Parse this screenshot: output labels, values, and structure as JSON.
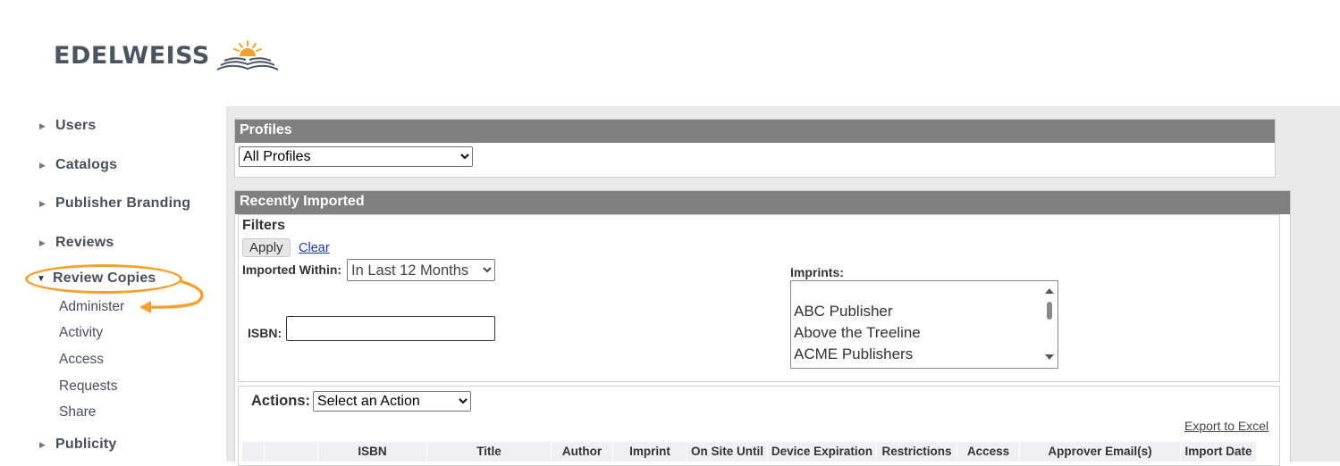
{
  "brand": {
    "logo_text": "EDELWEISS"
  },
  "sidebar": {
    "sections": [
      {
        "label": "Users",
        "expanded": false
      },
      {
        "label": "Catalogs",
        "expanded": false
      },
      {
        "label": "Publisher Branding",
        "expanded": false
      },
      {
        "label": "Reviews",
        "expanded": false
      },
      {
        "label": "Review Copies",
        "expanded": true
      },
      {
        "label": "Publicity",
        "expanded": false
      }
    ],
    "review_copies_items": [
      "Administer",
      "Activity",
      "Access",
      "Requests",
      "Share"
    ]
  },
  "profiles": {
    "header": "Profiles",
    "selected": "All Profiles"
  },
  "recently_imported": {
    "header": "Recently Imported",
    "filters": {
      "title": "Filters",
      "apply_label": "Apply",
      "clear_label": "Clear",
      "imported_within_label": "Imported Within:",
      "imported_within_value": "In Last 12 Months",
      "isbn_label": "ISBN:",
      "isbn_value": "",
      "imprints_label": "Imprints:",
      "imprints": [
        "ABC Publisher",
        "Above the Treeline",
        "ACME Publishers"
      ]
    },
    "actions": {
      "label": "Actions:",
      "selected": "Select an Action",
      "export_label": "Export to Excel"
    },
    "table_columns": [
      "",
      "",
      "ISBN",
      "Title",
      "Author",
      "Imprint",
      "On Site Until",
      "Device Expiration",
      "Restrictions",
      "Access",
      "Approver Email(s)",
      "Import Date"
    ]
  },
  "colors": {
    "highlight": "#f3a230",
    "header_bg": "#808080",
    "link": "#1a3ab8"
  }
}
